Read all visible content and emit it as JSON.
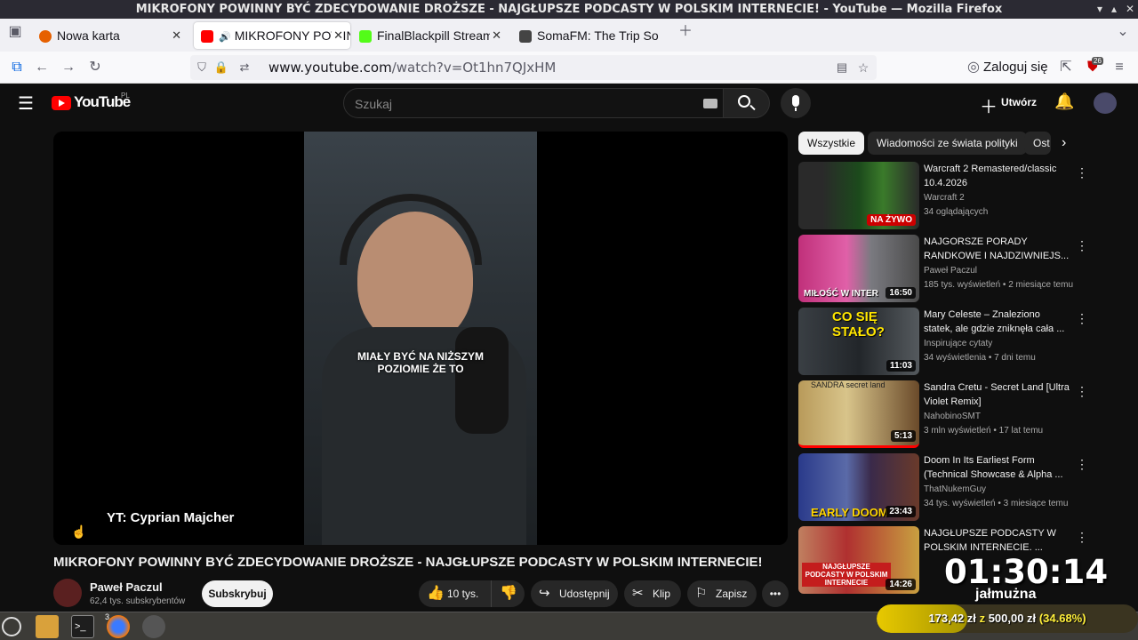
{
  "window": {
    "title": "MIKROFONY POWINNY BYĆ ZDECYDOWANIE DROŻSZE - NAJGŁUPSZE PODCASTY W POLSKIM INTERNECIE! - YouTube — Mozilla Firefox"
  },
  "tabs": [
    {
      "label": "Nowa karta",
      "color": "#e66000"
    },
    {
      "label": "MIKROFONY POWINNY BYĆ",
      "color": "#ff0000"
    },
    {
      "label": "FinalBlackpill Stream",
      "color": "#53fc18"
    },
    {
      "label": "SomaFM: The Trip So",
      "color": "#222222"
    }
  ],
  "nav": {
    "url_domain": "www.youtube.com",
    "url_path": "/watch?v=Ot1hn7QJxHM",
    "login_label": "Zaloguj się",
    "ext_badge": "26"
  },
  "youtube": {
    "logo_text": "YouTube",
    "region": "PL",
    "search_placeholder": "Szukaj",
    "create_label": "Utwórz"
  },
  "player": {
    "subtitle_line1": "MIAŁY BYĆ NA NIŻSZYM",
    "subtitle_line2": "POZIOMIE ŻE TO",
    "credit": "YT: Cyprian Majcher"
  },
  "video": {
    "title": "MIKROFONY POWINNY BYĆ ZDECYDOWANIE DROŻSZE - NAJGŁUPSZE PODCASTY W POLSKIM INTERNECIE!",
    "channel": "Paweł Paczul",
    "subscribers": "62,4 tys. subskrybentów",
    "subscribe_label": "Subskrybuj",
    "likes": "10 tys.",
    "share_label": "Udostępnij",
    "clip_label": "Klip",
    "save_label": "Zapisz"
  },
  "chips": [
    "Wszystkie",
    "Wiadomości ze świata polityki",
    "Ost"
  ],
  "recommendations": [
    {
      "title": "Warcraft 2 Remastered/classic 10.4.2026",
      "channel": "Warcraft 2",
      "meta": "34 oglądających",
      "badge": "NA ŻYWO",
      "duration": ""
    },
    {
      "title": "NAJGORSZE PORADY RANDKOWE I NAJDZIWNIEJS...",
      "channel": "Paweł Paczul",
      "meta": "185 tys. wyświetleń • 2 miesiące temu",
      "badge": "",
      "duration": "16:50"
    },
    {
      "title": "Mary Celeste – Znaleziono statek, ale gdzie zniknęła cała ...",
      "channel": "Inspirujące cytaty",
      "meta": "34 wyświetlenia • 7 dni temu",
      "badge": "",
      "duration": "11:03"
    },
    {
      "title": "Sandra Cretu - Secret Land [Ultra Violet Remix]",
      "channel": "NahobinoSMT",
      "meta": "3 mln wyświetleń • 17 lat temu",
      "badge": "",
      "duration": "5:13"
    },
    {
      "title": "Doom In Its Earliest Form (Technical Showcase & Alpha ...",
      "channel": "ThatNukemGuy",
      "meta": "34 tys. wyświetleń • 3 miesiące temu",
      "badge": "",
      "duration": "23:43"
    },
    {
      "title": "NAJGŁUPSZE PODCASTY W POLSKIM INTERNECIE. ...",
      "channel": "",
      "meta": "",
      "badge": "",
      "duration": "14:26"
    }
  ],
  "thumb_texts": {
    "t2": "MIŁOŚĆ W INTER",
    "t3": "CO SIĘ STAŁO?",
    "t4": "SANDRA secret land",
    "t5": "EARLY DOOM",
    "t6": "NAJGŁUPSZE PODCASTY W POLSKIM INTERNECIE"
  },
  "overlay": {
    "timer": "01:30:14",
    "timer_label": "jałmużna",
    "donation_amount": "173,42 zł",
    "donation_sep": "z",
    "donation_goal": "500,00 zł",
    "donation_pct": "(34.68%)",
    "donation_fraction": 0.3468
  },
  "taskbar": {
    "terminal_badge": "3"
  }
}
